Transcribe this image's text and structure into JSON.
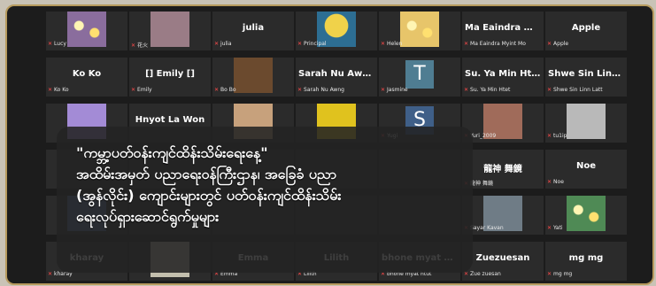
{
  "tiles": [
    {
      "name": "",
      "foot": "Lucy",
      "thumb": "flowers",
      "color": "#8a6d9d"
    },
    {
      "name": "",
      "foot": "花火",
      "thumb": "art",
      "color": "#9a7c86"
    },
    {
      "name": "julia",
      "foot": "julia"
    },
    {
      "name": "",
      "foot": "Principal",
      "thumb": "logo",
      "color": "#2d6e93"
    },
    {
      "name": "",
      "foot": "Helen",
      "thumb": "flowers",
      "color": "#e7c56a"
    },
    {
      "name": "Ma Eaindra Myi...",
      "foot": "Ma Eaindra Myint Mo"
    },
    {
      "name": "Apple",
      "foot": "Apple"
    },
    {
      "name": "Ko Ko",
      "foot": "Ko Ko"
    },
    {
      "name": "[] Emily []",
      "foot": "Emily"
    },
    {
      "name": "",
      "foot": "Bo Bo",
      "thumb": "art",
      "color": "#6b4a2e"
    },
    {
      "name": "Sarah Nu Awng",
      "foot": "Sarah Nu Awng"
    },
    {
      "name": "",
      "foot": "Jasmine",
      "letter": "T",
      "color": "#4f7d92"
    },
    {
      "name": "Su. Ya Min Htet",
      "foot": "Su. Ya Min Htet"
    },
    {
      "name": "Shwe Sin Linn L...",
      "foot": "Shwe Sin Linn Latt"
    },
    {
      "name": "",
      "foot": "",
      "thumb": "art",
      "color": "#a38bd6"
    },
    {
      "name": "Hnyot La Won",
      "foot": ""
    },
    {
      "name": "",
      "foot": "",
      "thumb": "art",
      "color": "#c7a17c"
    },
    {
      "name": "",
      "foot": "",
      "thumb": "art",
      "color": "#e0c21e"
    },
    {
      "name": "",
      "foot": "Yugi",
      "letter": "S",
      "color": "#3f5f88"
    },
    {
      "name": "",
      "foot": "Yuri_2009",
      "thumb": "art",
      "color": "#a06b5a"
    },
    {
      "name": "",
      "foot": "tu1ip",
      "thumb": "art",
      "color": "#b9b9b9"
    },
    {
      "name": "",
      "foot": ""
    },
    {
      "name": "",
      "foot": ""
    },
    {
      "name": "",
      "foot": ""
    },
    {
      "name": "",
      "foot": ""
    },
    {
      "name": "",
      "foot": ""
    },
    {
      "name": "龍神 舞鏡",
      "foot": "龍神 舞鏡"
    },
    {
      "name": "Noe",
      "foot": "Noe"
    },
    {
      "name": "",
      "foot": "",
      "thumb": "art",
      "color": "#546d9a"
    },
    {
      "name": "",
      "foot": ""
    },
    {
      "name": "",
      "foot": ""
    },
    {
      "name": "",
      "foot": ""
    },
    {
      "name": "",
      "foot": ""
    },
    {
      "name": "",
      "foot": "Sayar Kavan",
      "thumb": "art",
      "color": "#6f7c86"
    },
    {
      "name": "",
      "foot": "Yati",
      "thumb": "flowers",
      "color": "#4f8a55"
    },
    {
      "name": "kharay",
      "foot": "kharay"
    },
    {
      "name": "",
      "foot": "",
      "thumb": "art",
      "color": "#c3bfae"
    },
    {
      "name": "Emma",
      "foot": "Emma"
    },
    {
      "name": "Lilith",
      "foot": "Lilith"
    },
    {
      "name": "bhone myat htut",
      "foot": "bhone myat htut"
    },
    {
      "name": "Zuezuesan",
      "foot": "Zue zuesan"
    },
    {
      "name": "mg mg",
      "foot": "mg mg"
    }
  ],
  "caption": {
    "line1": "\"ကမ္ဘာ့ပတ်ဝန်းကျင်ထိန်းသိမ်းရေးနေ့\"",
    "line2": "အထိမ်းအမှတ် ပညာရေးဝန်ကြီးဌာန၊ အခြေခံ ပညာ",
    "line3": "(အွန်လိုင်း) ကျောင်းများတွင် ပတ်ဝန်းကျင်ထိန်းသိမ်း",
    "line4": "ရေးလုပ်ရှားဆောင်ရွက်မှုများ"
  }
}
